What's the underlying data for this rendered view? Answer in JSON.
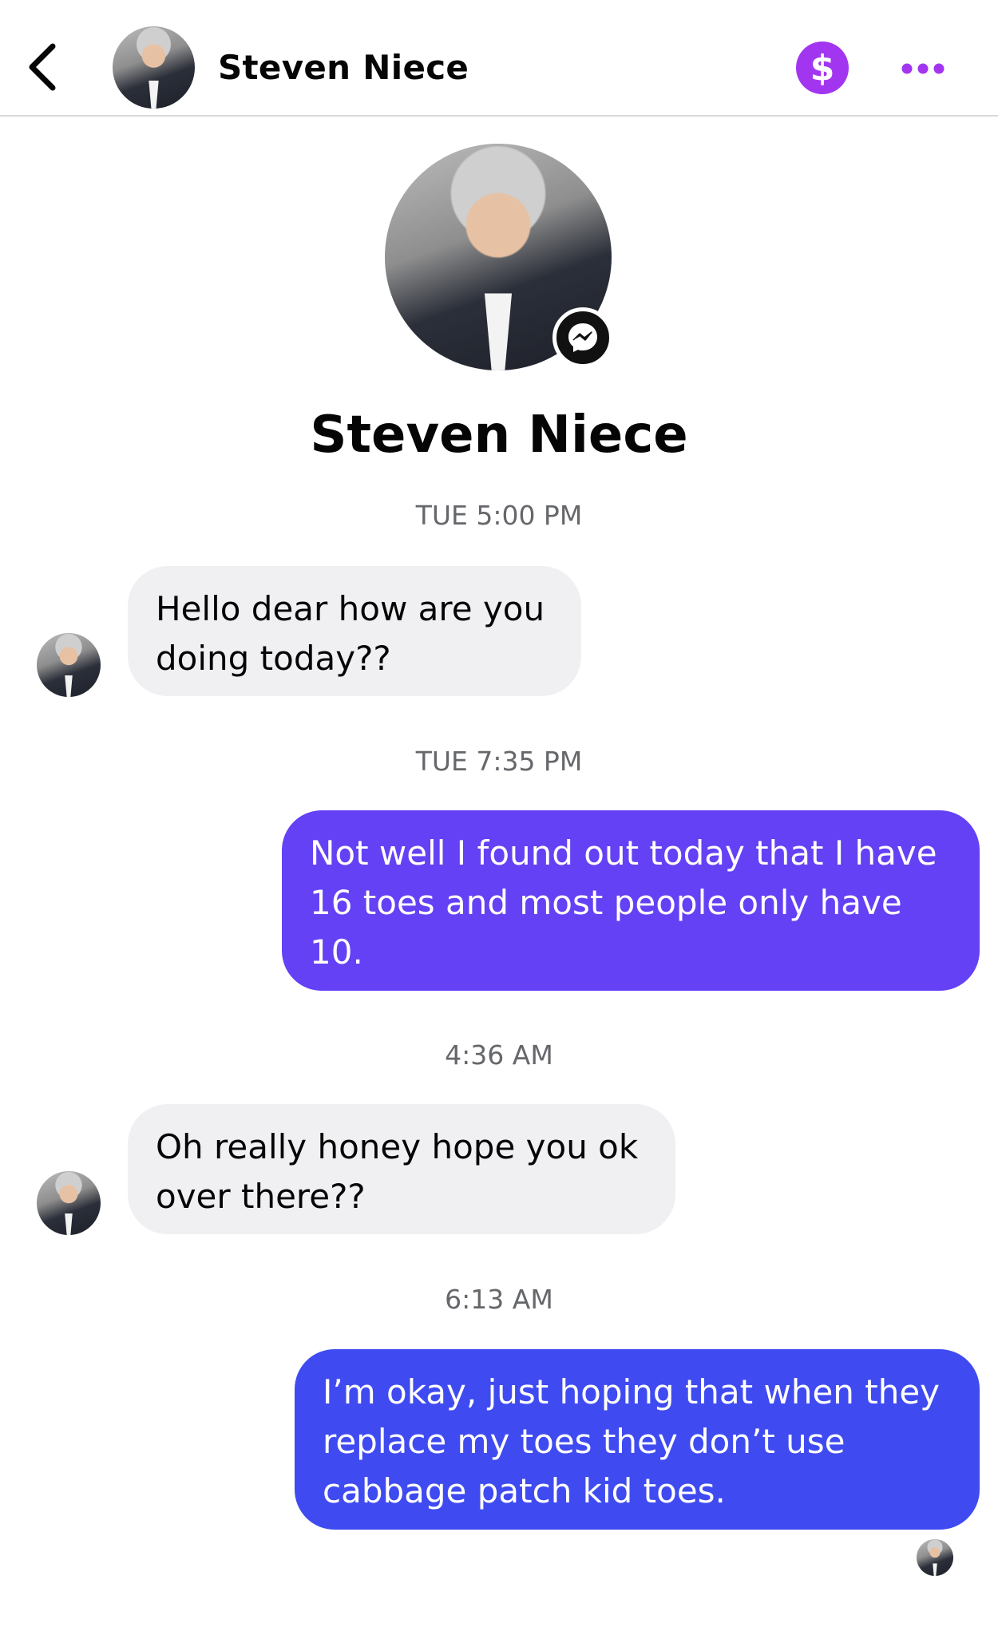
{
  "header": {
    "contact_name": "Steven Niece",
    "back_icon": "chevron-left-icon",
    "payment_icon": "dollar-sign-icon",
    "payment_symbol": "$",
    "more_icon": "more-horizontal-icon"
  },
  "profile": {
    "name": "Steven Niece",
    "badge_icon": "messenger-icon"
  },
  "colors": {
    "accent_purple": "#a236f0",
    "outgoing_1": "#6441f5",
    "outgoing_2": "#3f4bf0",
    "incoming_bg": "#f0f0f3"
  },
  "messages": [
    {
      "timestamp": "TUE 5:00 PM",
      "direction": "incoming",
      "text": "Hello dear how are you doing today??"
    },
    {
      "timestamp": "TUE 7:35 PM",
      "direction": "outgoing",
      "text": "Not well I found out today that I have 16 toes and most people only have 10."
    },
    {
      "timestamp": "4:36 AM",
      "direction": "incoming",
      "text": "Oh really honey hope you ok over there??"
    },
    {
      "timestamp": "6:13 AM",
      "direction": "outgoing",
      "text": "I’m okay, just hoping that when they replace my toes they don’t use cabbage patch kid toes."
    }
  ]
}
